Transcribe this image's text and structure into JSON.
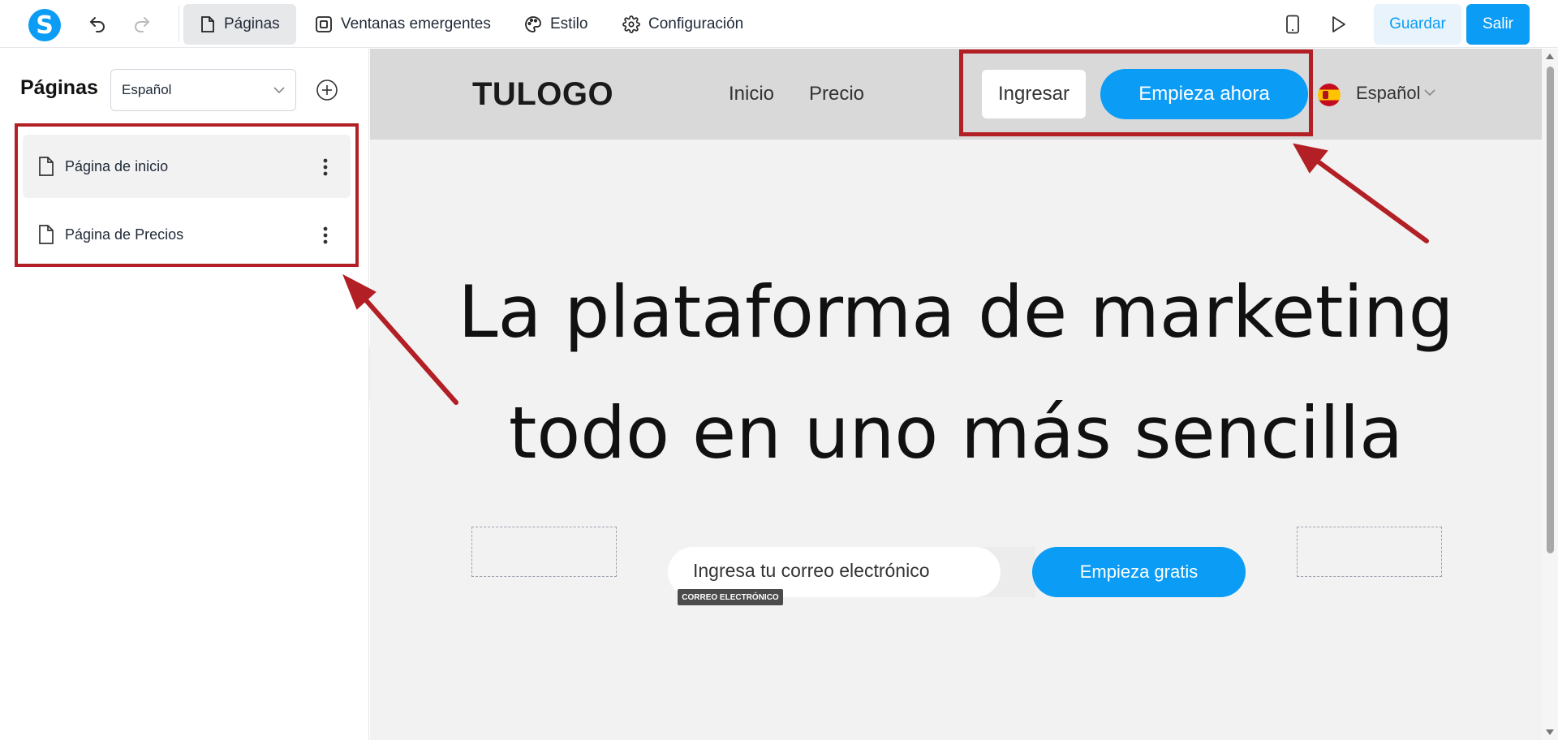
{
  "toolbar": {
    "logo_letter": "S",
    "tabs": [
      {
        "label": "Páginas",
        "icon": "page-icon"
      },
      {
        "label": "Ventanas emergentes",
        "icon": "popup-icon"
      },
      {
        "label": "Estilo",
        "icon": "palette-icon"
      },
      {
        "label": "Configuración",
        "icon": "gear-icon"
      }
    ],
    "save_label": "Guardar",
    "exit_label": "Salir"
  },
  "sidebar": {
    "title": "Páginas",
    "language_select": "Español",
    "pages": [
      {
        "label": "Página de inicio",
        "selected": true
      },
      {
        "label": "Página de Precios",
        "selected": false
      }
    ]
  },
  "preview": {
    "logo": "TULOGO",
    "nav": [
      "Inicio",
      "Precio"
    ],
    "login_label": "Ingresar",
    "cta_label": "Empieza ahora",
    "language": "Español",
    "hero_line1": "La plataforma de marketing",
    "hero_line2": "todo en uno más sencilla",
    "email_placeholder": "Ingresa tu correo electrónico",
    "email_tag": "CORREO ELECTRÓNICO",
    "signup_label": "Empieza gratis"
  },
  "colors": {
    "accent": "#0b9cf5",
    "annotation": "#b21f24"
  }
}
